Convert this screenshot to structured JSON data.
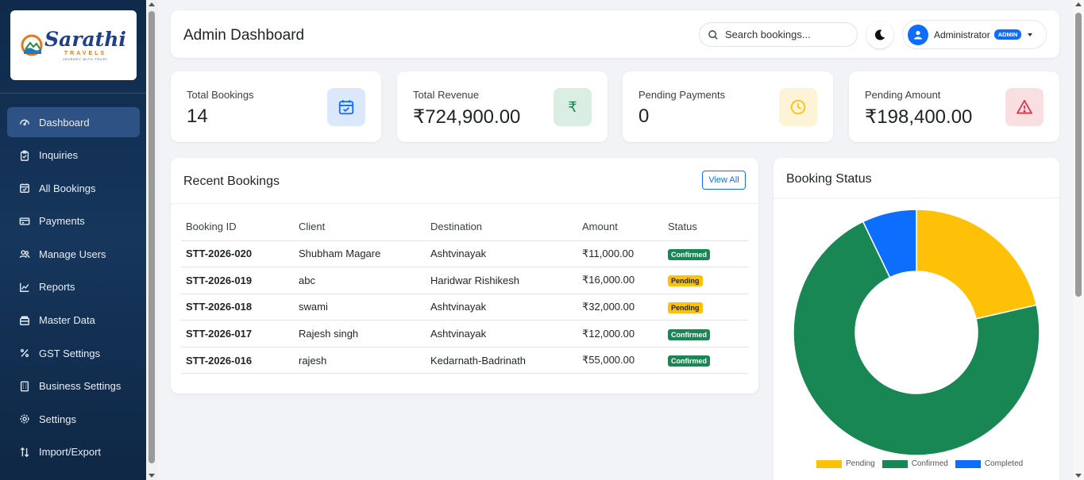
{
  "brand": {
    "name": "Sarathi",
    "sub": "TRAVELS",
    "tagline": "JOURNEY WITH TRUST"
  },
  "sidebar": {
    "items": [
      {
        "label": "Dashboard",
        "icon": "gauge-icon",
        "active": true
      },
      {
        "label": "Inquiries",
        "icon": "clipboard-icon"
      },
      {
        "label": "All Bookings",
        "icon": "calendar-check-icon"
      },
      {
        "label": "Payments",
        "icon": "credit-card-icon"
      },
      {
        "label": "Manage Users",
        "icon": "users-icon"
      },
      {
        "label": "Reports",
        "icon": "line-chart-icon"
      },
      {
        "label": "Master Data",
        "icon": "archive-icon"
      },
      {
        "label": "GST Settings",
        "icon": "percent-icon"
      },
      {
        "label": "Business Settings",
        "icon": "building-icon"
      },
      {
        "label": "Settings",
        "icon": "gear-icon"
      },
      {
        "label": "Import/Export",
        "icon": "arrows-updown-icon"
      }
    ]
  },
  "header": {
    "title": "Admin Dashboard",
    "search_placeholder": "Search bookings...",
    "user_name": "Administrator",
    "user_badge": "ADMIN"
  },
  "stats": [
    {
      "label": "Total Bookings",
      "value": "14",
      "icon": "calendar-icon",
      "color": "#0d6efd",
      "bg": "#dbe8fb"
    },
    {
      "label": "Total Revenue",
      "value": "₹724,900.00",
      "icon": "rupee-icon",
      "color": "#198754",
      "bg": "#dbeee3"
    },
    {
      "label": "Pending Payments",
      "value": "0",
      "icon": "clock-icon",
      "color": "#ffc107",
      "bg": "#fdf3d6"
    },
    {
      "label": "Pending Amount",
      "value": "₹198,400.00",
      "icon": "warning-icon",
      "color": "#dc3545",
      "bg": "#f9dfe1"
    }
  ],
  "recent": {
    "title": "Recent Bookings",
    "view_all": "View All",
    "columns": [
      "Booking ID",
      "Client",
      "Destination",
      "Amount",
      "Status"
    ],
    "rows": [
      {
        "id": "STT-2026-020",
        "client": "Shubham Magare",
        "destination": "Ashtvinayak",
        "amount": "₹11,000.00",
        "status": "Confirmed"
      },
      {
        "id": "STT-2026-019",
        "client": "abc",
        "destination": "Haridwar Rishikesh",
        "amount": "₹16,000.00",
        "status": "Pending"
      },
      {
        "id": "STT-2026-018",
        "client": "swami",
        "destination": "Ashtvinayak",
        "amount": "₹32,000.00",
        "status": "Pending"
      },
      {
        "id": "STT-2026-017",
        "client": "Rajesh singh",
        "destination": "Ashtvinayak",
        "amount": "₹12,000.00",
        "status": "Confirmed"
      },
      {
        "id": "STT-2026-016",
        "client": "rajesh",
        "destination": "Kedarnath-Badrinath",
        "amount": "₹55,000.00",
        "status": "Confirmed"
      }
    ]
  },
  "chart_data": {
    "type": "pie",
    "title": "Booking Status",
    "categories": [
      "Pending",
      "Confirmed",
      "Completed"
    ],
    "values": [
      3,
      10,
      1
    ],
    "colors": [
      "#ffc107",
      "#198754",
      "#0d6efd"
    ],
    "donut": true,
    "legend": "bottom"
  }
}
